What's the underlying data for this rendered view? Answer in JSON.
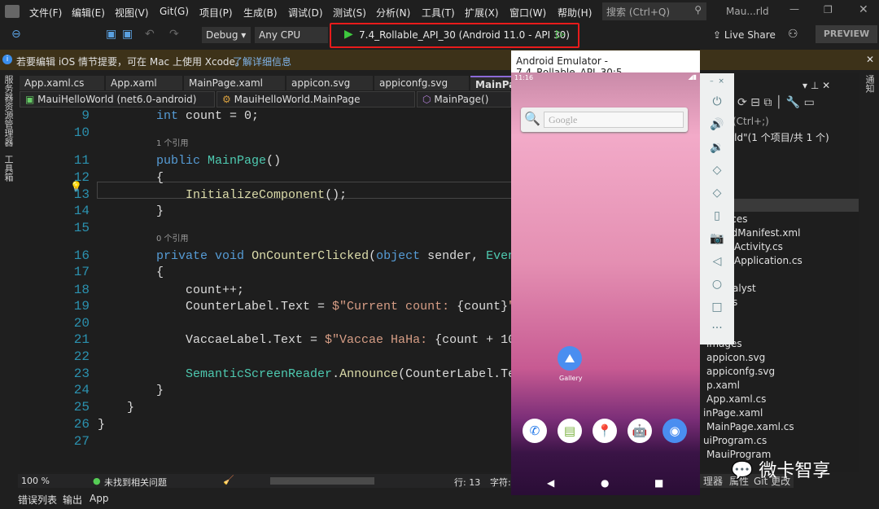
{
  "menu": {
    "items": [
      "文件(F)",
      "编辑(E)",
      "视图(V)",
      "Git(G)",
      "项目(P)",
      "生成(B)",
      "调试(D)",
      "测试(S)",
      "分析(N)",
      "工具(T)",
      "扩展(X)",
      "窗口(W)",
      "帮助(H)"
    ],
    "search_placeholder": "搜索 (Ctrl+Q)",
    "window_title": "Mau...rld"
  },
  "toolbar": {
    "config": "Debug",
    "platform": "Any CPU",
    "run_target": "7.4_Rollable_API_30 (Android 11.0 - API 30)",
    "live_share": "Live Share",
    "preview": "PREVIEW"
  },
  "infobar": {
    "message": "若要编辑 iOS 情节提要，可在 Mac 上使用 Xcode。",
    "link": "了解详细信息"
  },
  "left_strip": [
    "服务器资源管理器",
    "工具箱"
  ],
  "right_strip": "通知",
  "tabs": [
    "App.xaml.cs",
    "App.xaml",
    "MainPage.xaml",
    "appicon.svg",
    "appiconfg.svg",
    "MainPag"
  ],
  "nav": {
    "project": "MauiHelloWorld (net6.0-android)",
    "class": "MauiHelloWorld.MainPage",
    "member": "MainPage()"
  },
  "code": {
    "lens1": "1 个引用",
    "lens2": "0 个引用",
    "lines": [
      {
        "n": "9",
        "t": [
          [
            "        ",
            ""
          ],
          [
            "int",
            "kw"
          ],
          [
            " count = 0;",
            ""
          ]
        ]
      },
      {
        "n": "10",
        "t": []
      },
      {
        "n": "11",
        "t": [
          [
            "        ",
            ""
          ],
          [
            "public",
            "kw"
          ],
          [
            " ",
            ""
          ],
          [
            "MainPage",
            "ty"
          ],
          [
            "()",
            ""
          ]
        ]
      },
      {
        "n": "12",
        "t": [
          [
            "        {",
            ""
          ]
        ]
      },
      {
        "n": "13",
        "t": [
          [
            "            ",
            ""
          ],
          [
            "InitializeComponent",
            "fn"
          ],
          [
            "();",
            ""
          ]
        ]
      },
      {
        "n": "14",
        "t": [
          [
            "        }",
            ""
          ]
        ]
      },
      {
        "n": "15",
        "t": []
      },
      {
        "n": "16",
        "t": [
          [
            "        ",
            ""
          ],
          [
            "private",
            "kw"
          ],
          [
            " ",
            ""
          ],
          [
            "void",
            "kw"
          ],
          [
            " ",
            ""
          ],
          [
            "OnCounterClicked",
            "fn"
          ],
          [
            "(",
            ""
          ],
          [
            "object",
            "kw"
          ],
          [
            " sender, ",
            ""
          ],
          [
            "Even",
            "ty"
          ]
        ]
      },
      {
        "n": "17",
        "t": [
          [
            "        {",
            ""
          ]
        ]
      },
      {
        "n": "18",
        "t": [
          [
            "            count++;",
            ""
          ]
        ]
      },
      {
        "n": "19",
        "t": [
          [
            "            CounterLabel.Text = ",
            ""
          ],
          [
            "$\"Current count: ",
            "st"
          ],
          [
            "{count}",
            ""
          ],
          [
            "\"",
            "st"
          ]
        ]
      },
      {
        "n": "20",
        "t": []
      },
      {
        "n": "21",
        "t": [
          [
            "            VaccaeLabel.Text = ",
            ""
          ],
          [
            "$\"Vaccae HaHa: ",
            "st"
          ],
          [
            "{count + 10",
            ""
          ]
        ]
      },
      {
        "n": "22",
        "t": []
      },
      {
        "n": "23",
        "t": [
          [
            "            ",
            ""
          ],
          [
            "SemanticScreenReader",
            "ty"
          ],
          [
            ".",
            ""
          ],
          [
            "Announce",
            "fn"
          ],
          [
            "(CounterLabel.Te",
            ""
          ]
        ]
      },
      {
        "n": "24",
        "t": [
          [
            "        }",
            ""
          ]
        ]
      },
      {
        "n": "25",
        "t": [
          [
            "    }",
            ""
          ]
        ]
      },
      {
        "n": "26",
        "t": [
          [
            "}",
            ""
          ]
        ]
      },
      {
        "n": "27",
        "t": []
      }
    ]
  },
  "status": {
    "zoom": "100 %",
    "issues": "未找到相关问题",
    "line": "行: 13",
    "char": "字符:"
  },
  "bottom_tabs": [
    "错误列表",
    "输出",
    "App"
  ],
  "emulator": {
    "title": "Android Emulator - 7.4_Rollable_API_30:5...",
    "time": "11:16",
    "search_hint": "Google",
    "gallery": "Gallery"
  },
  "solution": {
    "search": "(Ctrl+;)",
    "items": [
      "loWorld\"(1 个项目/共 1 个)",
      "rld",
      "urces",
      "oidManifest.xml",
      "Activity.cs",
      "Application.cs",
      "alyst",
      "s",
      "images",
      "appicon.svg",
      "appiconfg.svg",
      "p.xaml",
      "App.xaml.cs",
      "inPage.xaml",
      "MainPage.xaml.cs",
      "uiProgram.cs",
      "MauiProgram"
    ],
    "tabs": [
      "理器",
      "属性",
      "Git 更改"
    ]
  },
  "watermark": "微卡智享",
  "colors": {
    "accent": "#e81b1b",
    "infobar": "#3d3219",
    "run": "#3ec93e"
  }
}
